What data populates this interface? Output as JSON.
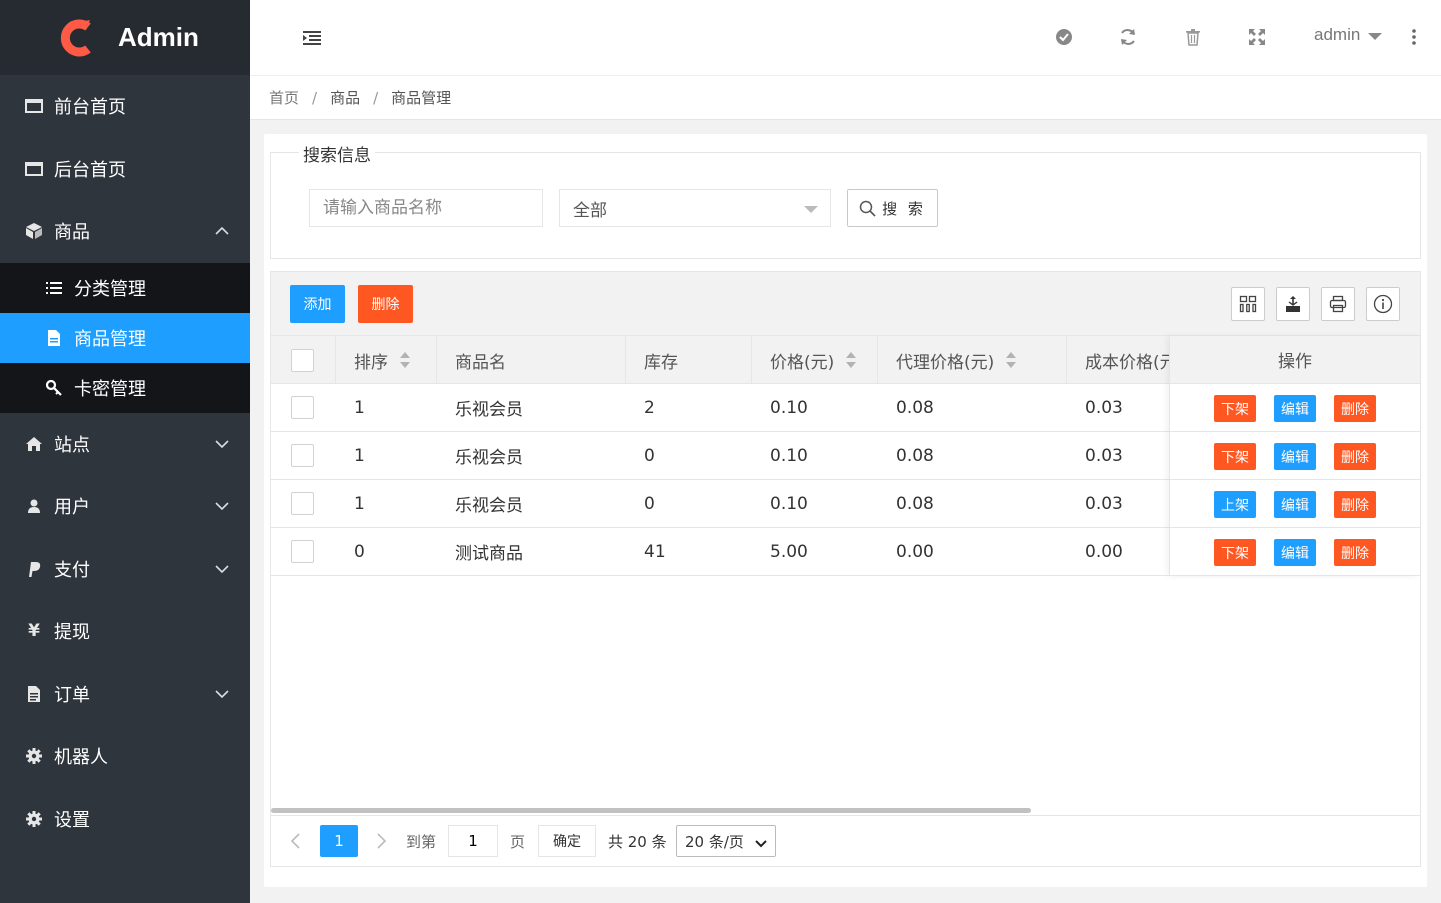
{
  "app": {
    "name": "Admin"
  },
  "sidebar": {
    "items": [
      {
        "label": "前台首页",
        "icon": "window-icon"
      },
      {
        "label": "后台首页",
        "icon": "window-icon"
      },
      {
        "label": "商品",
        "icon": "cube-icon",
        "expanded": true,
        "children": [
          {
            "label": "分类管理",
            "icon": "list-icon"
          },
          {
            "label": "商品管理",
            "icon": "file-icon",
            "active": true
          },
          {
            "label": "卡密管理",
            "icon": "key-icon"
          }
        ]
      },
      {
        "label": "站点",
        "icon": "home-icon"
      },
      {
        "label": "用户",
        "icon": "user-icon"
      },
      {
        "label": "支付",
        "icon": "paypal-icon"
      },
      {
        "label": "提现",
        "icon": "yen-icon",
        "icon_glyph": "¥"
      },
      {
        "label": "订单",
        "icon": "document-icon"
      },
      {
        "label": "机器人",
        "icon": "gear-icon"
      },
      {
        "label": "设置",
        "icon": "gear-icon"
      }
    ]
  },
  "header": {
    "user": "admin"
  },
  "breadcrumb": [
    "首页",
    "商品",
    "商品管理"
  ],
  "search": {
    "legend": "搜索信息",
    "name_placeholder": "请输入商品名称",
    "name_value": "",
    "status_value": "全部",
    "button_label": "搜 索"
  },
  "toolbar": {
    "add_label": "添加",
    "delete_label": "删除"
  },
  "table": {
    "columns": [
      "排序",
      "商品名",
      "库存",
      "价格(元)",
      "代理价格(元)",
      "成本价格(元",
      "操作"
    ],
    "rows": [
      {
        "sort": "1",
        "name": "乐视会员",
        "stock": "2",
        "price": "0.10",
        "agent_price": "0.08",
        "cost": "0.03",
        "toggle": "下架",
        "edit": "编辑",
        "del": "删除"
      },
      {
        "sort": "1",
        "name": "乐视会员",
        "stock": "0",
        "price": "0.10",
        "agent_price": "0.08",
        "cost": "0.03",
        "toggle": "下架",
        "edit": "编辑",
        "del": "删除"
      },
      {
        "sort": "1",
        "name": "乐视会员",
        "stock": "0",
        "price": "0.10",
        "agent_price": "0.08",
        "cost": "0.03",
        "toggle": "上架",
        "edit": "编辑",
        "del": "删除"
      },
      {
        "sort": "0",
        "name": "测试商品",
        "stock": "41",
        "price": "5.00",
        "agent_price": "0.00",
        "cost": "0.00",
        "toggle": "下架",
        "edit": "编辑",
        "del": "删除"
      }
    ]
  },
  "pagination": {
    "current": "1",
    "goto_label": "到第",
    "goto_value": "1",
    "page_suffix": "页",
    "confirm": "确定",
    "total": "共 20 条",
    "per_page": "20 条/页"
  },
  "colors": {
    "primary": "#1e9fff",
    "danger": "#ff5722",
    "sidebar": "#2f353d",
    "logo": "#ff5a45"
  }
}
